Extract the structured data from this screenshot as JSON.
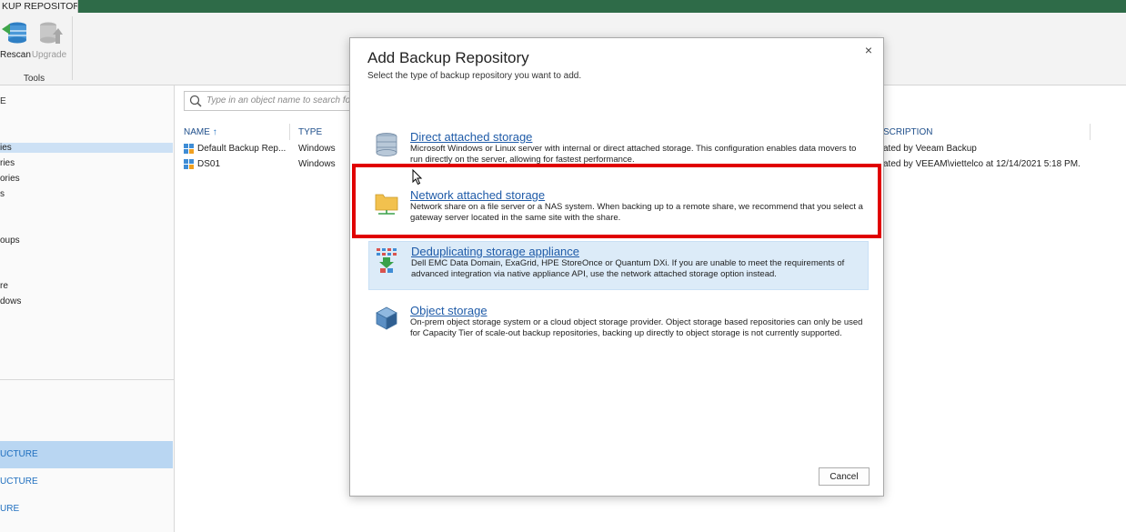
{
  "ribbon": {
    "tab_label": "KUP REPOSITORY",
    "rescan_label": "Rescan",
    "upgrade_label": "Upgrade",
    "group_label": "Tools"
  },
  "leftnav": {
    "heading": "E",
    "items": [
      "ies",
      "ries",
      "ories",
      "s",
      "oups",
      "re",
      "dows"
    ],
    "bottom": [
      "UCTURE",
      "UCTURE",
      "URE"
    ]
  },
  "main": {
    "search_placeholder": "Type in an object name to search for",
    "columns": {
      "name": "NAME",
      "sort_icon": "↑",
      "type": "TYPE",
      "description": "SCRIPTION"
    },
    "rows": [
      {
        "name": "Default Backup Rep...",
        "type": "Windows",
        "description": "ated by Veeam Backup"
      },
      {
        "name": "DS01",
        "type": "Windows",
        "description": "ated by VEEAM\\viettelco at 12/14/2021 5:18 PM."
      }
    ]
  },
  "dialog": {
    "title": "Add Backup Repository",
    "subtitle": "Select the type of backup repository you want to add.",
    "close_icon": "×",
    "cancel_label": "Cancel",
    "options": [
      {
        "title": "Direct attached storage",
        "description": "Microsoft Windows or Linux server with internal or direct attached storage. This configuration enables data movers to run directly on the server, allowing for fastest performance.",
        "icon": "database-icon"
      },
      {
        "title": "Network attached storage",
        "description": "Network share on a file server or a NAS system. When backing up to a remote share, we recommend that you select a gateway server located in the same site with the share.",
        "icon": "network-folder-icon"
      },
      {
        "title": "Deduplicating storage appliance",
        "description": "Dell EMC Data Domain, ExaGrid, HPE StoreOnce or Quantum DXi. If you are unable to meet the requirements of advanced integration via native appliance API, use the network attached storage option instead.",
        "icon": "dedup-appliance-icon"
      },
      {
        "title": "Object storage",
        "description": "On-prem object storage system or a cloud object storage provider. Object storage based repositories can only be used for Capacity Tier of scale-out backup repositories, backing up directly to object storage is not currently supported.",
        "icon": "object-storage-icon"
      }
    ]
  },
  "colors": {
    "brand_green": "#2e6b48",
    "link_blue": "#1f5ba8",
    "highlight_red": "#e00000",
    "hover_blue": "#dcebf8"
  }
}
